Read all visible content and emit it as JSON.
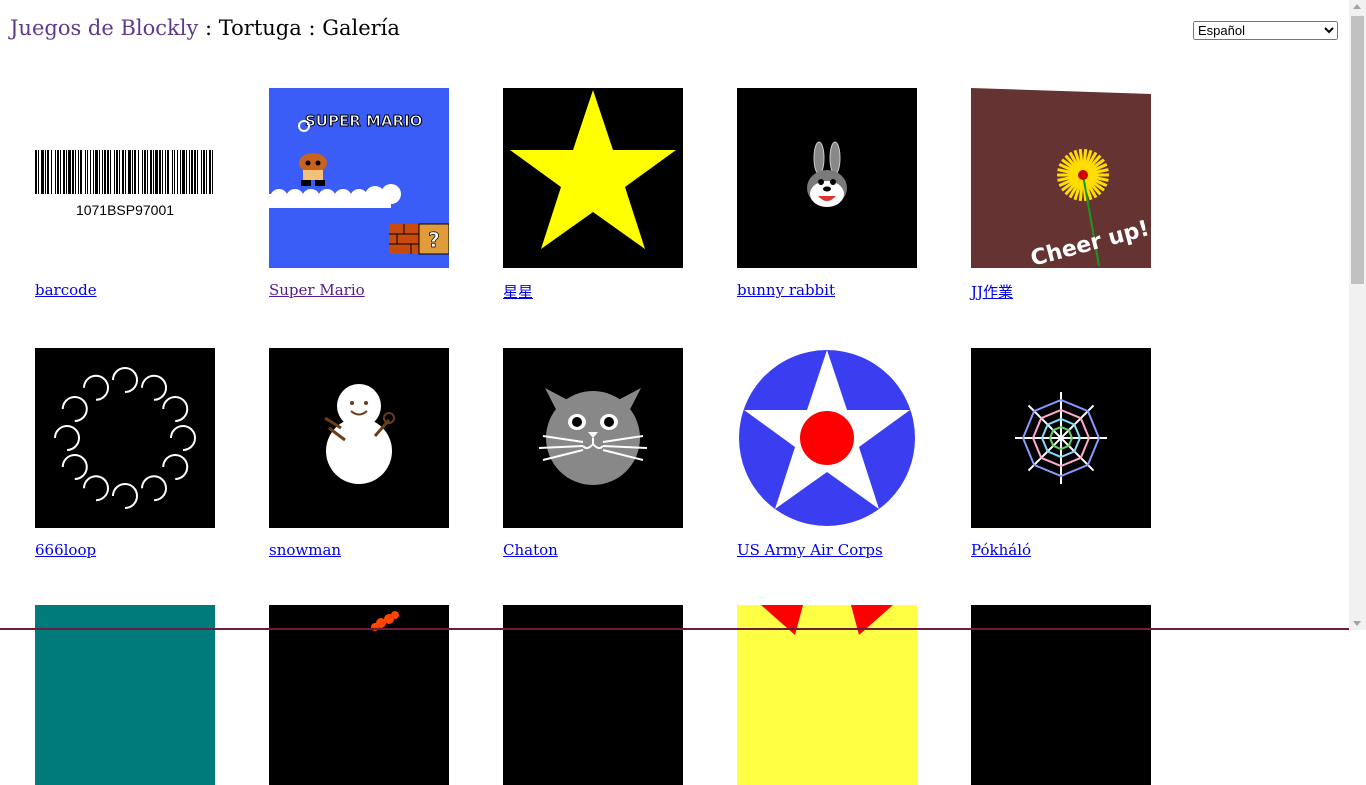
{
  "header": {
    "home_label": "Juegos de Blockly",
    "separator": " : ",
    "app": "Tortuga",
    "page": "Galería"
  },
  "language": {
    "selected": "Español"
  },
  "gallery": [
    {
      "title": "barcode",
      "barcode_text": "1071BSP97001"
    },
    {
      "title": "Super Mario",
      "banner_text": "SUPER MARIO"
    },
    {
      "title": "星星"
    },
    {
      "title": "bunny rabbit"
    },
    {
      "title": "JJ作業",
      "caption": "Cheer up!"
    },
    {
      "title": "666loop"
    },
    {
      "title": "snowman"
    },
    {
      "title": "Chaton"
    },
    {
      "title": "US Army Air Corps"
    },
    {
      "title": "Pókháló"
    }
  ],
  "colors": {
    "link": "#0000ee",
    "visited": "#551a8b",
    "home": "#5c3a8e"
  }
}
